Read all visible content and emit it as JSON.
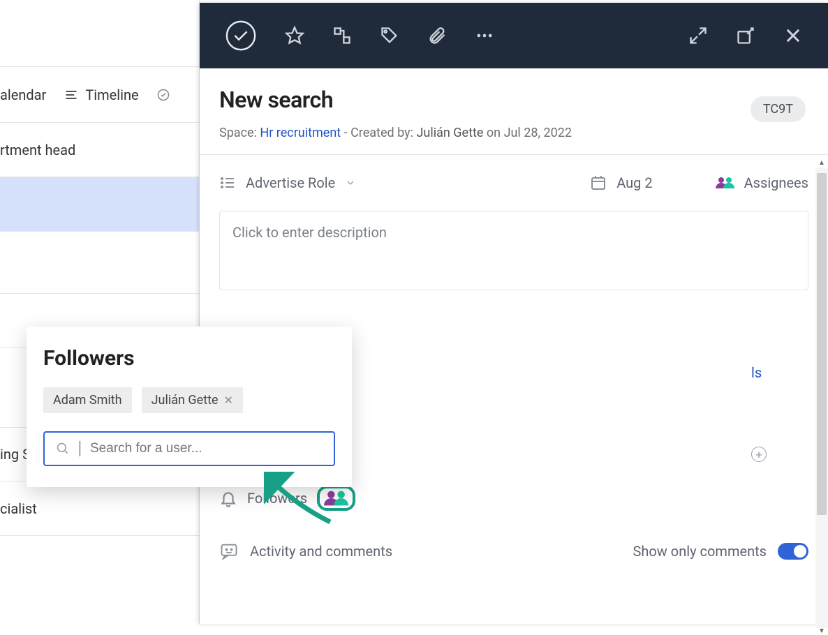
{
  "left": {
    "calendar_label": "alendar",
    "timeline_label": "Timeline",
    "row1": "rtment head",
    "row3": "ing Secialist",
    "row4": "cialist"
  },
  "toolbar": {
    "complete": "complete",
    "star": "star",
    "subtask": "subtask",
    "tag": "tag",
    "attach": "attach",
    "more": "more",
    "expand": "expand",
    "popout": "popout",
    "close": "close"
  },
  "task": {
    "title": "New search",
    "space_label": "Space:",
    "space_link": "Hr recruitment",
    "created_by_label": "- Created by:",
    "creator": "Julián Gette",
    "on_label": "on",
    "created_date": "Jul 28, 2022",
    "id_badge": "TC9T",
    "status": "Advertise Role",
    "due_date": "Aug 2",
    "assignees_label": "Assignees",
    "description_placeholder": "Click to enter description",
    "link_fragment": "ls"
  },
  "followers_section": {
    "label": "Followers"
  },
  "activity": {
    "label": "Activity and comments",
    "show_only_comments": "Show only comments",
    "toggle_on": true
  },
  "popover": {
    "title": "Followers",
    "chips": [
      {
        "name": "Adam Smith",
        "removable": false
      },
      {
        "name": "Julián Gette",
        "removable": true
      }
    ],
    "search_placeholder": "Search for a user..."
  }
}
